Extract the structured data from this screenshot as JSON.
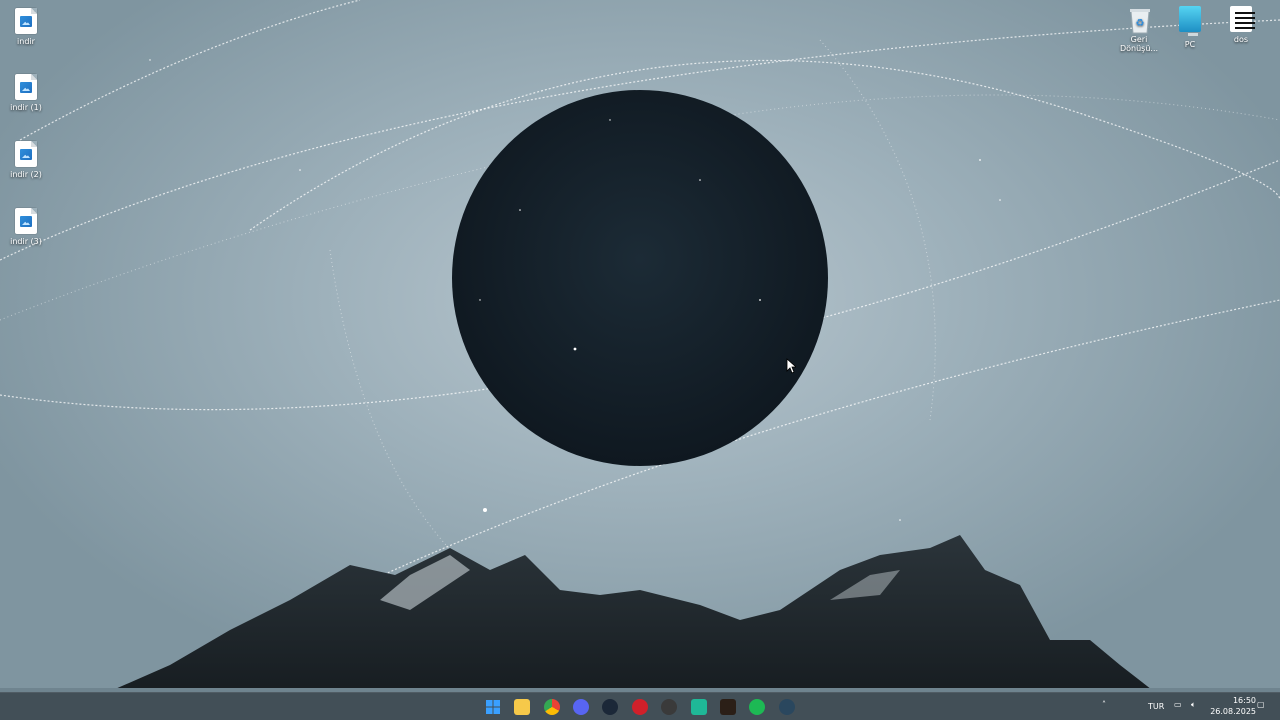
{
  "desktop": {
    "left_icons": [
      {
        "label": "indir",
        "icon": "image-file-icon"
      },
      {
        "label": "indir (1)",
        "icon": "image-file-icon"
      },
      {
        "label": "indir (2)",
        "icon": "image-file-icon"
      },
      {
        "label": "indir (3)",
        "icon": "image-file-icon"
      }
    ],
    "right_icons": [
      {
        "label": "Geri Dönüşü...",
        "icon": "recycle-bin-icon"
      },
      {
        "label": "PC",
        "icon": "monitor-icon"
      },
      {
        "label": "dos",
        "icon": "menu-lines-icon"
      }
    ]
  },
  "taskbar": {
    "apps": [
      {
        "name": "Start",
        "icon": "windows-logo-icon",
        "color": "#3aa0ff"
      },
      {
        "name": "File Explorer",
        "icon": "folder-icon",
        "color": "#f6c94a"
      },
      {
        "name": "Chrome",
        "icon": "chrome-icon",
        "color": "#e94335"
      },
      {
        "name": "Discord",
        "icon": "discord-icon",
        "color": "#5865f2"
      },
      {
        "name": "Steam",
        "icon": "steam-icon",
        "color": "#1b2838"
      },
      {
        "name": "Red App",
        "icon": "red-app-icon",
        "color": "#d0202a"
      },
      {
        "name": "Clock App",
        "icon": "clock-app-icon",
        "color": "#3a3a3a"
      },
      {
        "name": "Green App",
        "icon": "green-app-icon",
        "color": "#1fb897"
      },
      {
        "name": "Audio App",
        "icon": "audio-app-icon",
        "color": "#2b1f17"
      },
      {
        "name": "Spotify",
        "icon": "spotify-icon",
        "color": "#1db954"
      },
      {
        "name": "Steam",
        "icon": "steam-icon",
        "color": "#2a475e"
      }
    ],
    "tray": {
      "language": "TUR",
      "time": "16:50",
      "date": "26.08.2025"
    }
  }
}
